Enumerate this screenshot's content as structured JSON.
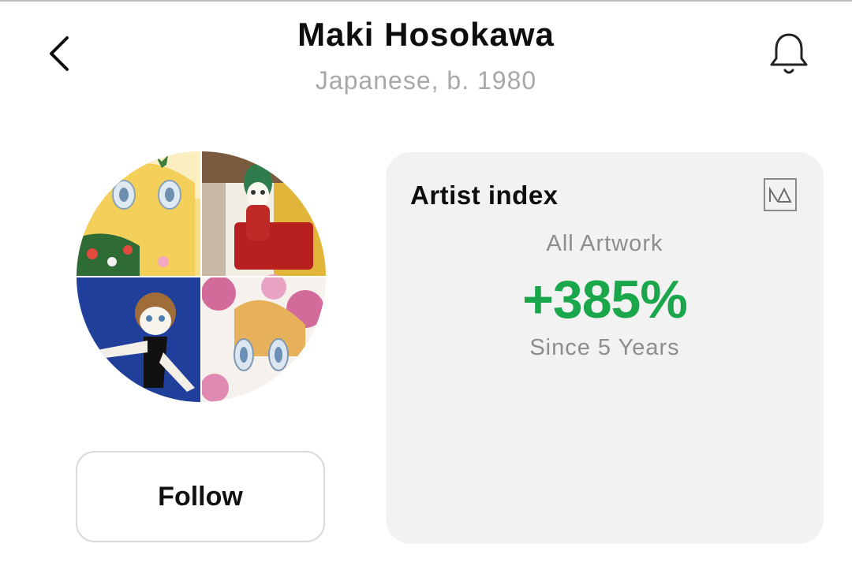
{
  "header": {
    "title": "Maki Hosokawa",
    "subtitle": "Japanese, b. 1980",
    "back_icon": "chevron-left-icon",
    "bell_icon": "bell-icon"
  },
  "profile": {
    "follow_label": "Follow"
  },
  "artist_index": {
    "heading": "Artist index",
    "icon": "chart-logo-icon",
    "scope": "All Artwork",
    "change": "+385%",
    "period": "Since 5 Years",
    "accent_color": "#1aa64a"
  }
}
